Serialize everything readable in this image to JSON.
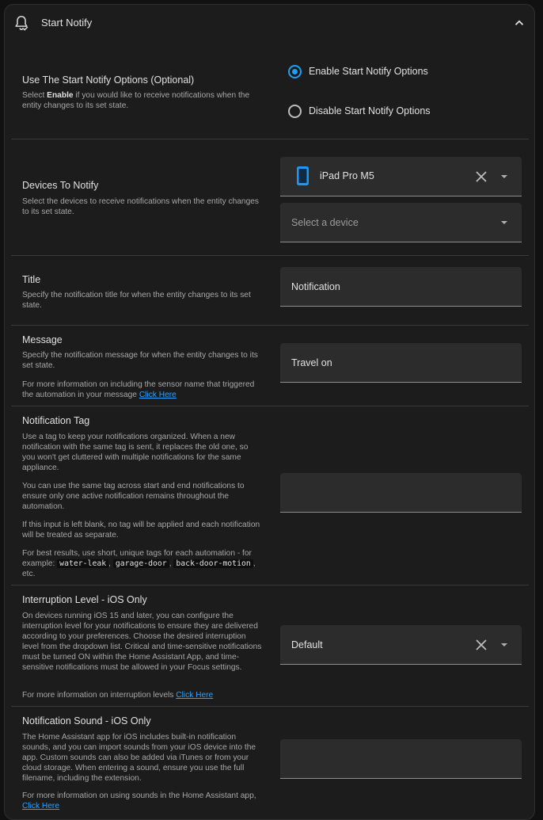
{
  "header": {
    "title": "Start Notify",
    "bell_icon": "bell-check-icon",
    "collapse_icon": "chevron-up-icon"
  },
  "start_options": {
    "title": "Use The Start Notify Options (Optional)",
    "desc_pre": "Select ",
    "desc_bold": "Enable",
    "desc_post": " if you would like to receive notifications when the entity changes to its set state.",
    "enable_label": "Enable Start Notify Options",
    "disable_label": "Disable Start Notify Options",
    "selected": "enable"
  },
  "devices": {
    "title": "Devices To Notify",
    "desc": "Select the devices to receive notifications when the entity changes to its set state.",
    "selected_device": "iPad Pro M5",
    "device_icon": "tablet-icon",
    "placeholder": "Select a device"
  },
  "title_field": {
    "title": "Title",
    "desc": "Specify the notification title for when the entity changes to its set state.",
    "value": "Notification"
  },
  "message_field": {
    "title": "Message",
    "desc": "Specify the notification message for when the entity changes to its set state.",
    "info": "For more information on including the sensor name that triggered the automation in your message ",
    "link": "Click Here",
    "value": "Travel on"
  },
  "tag_field": {
    "title": "Notification Tag",
    "p1": "Use a tag to keep your notifications organized. When a new notification with the same tag is sent, it replaces the old one, so you won't get cluttered with multiple notifications for the same appliance.",
    "p2": "You can use the same tag across start and end notifications to ensure only one active notification remains throughout the automation.",
    "p3": "If this input is left blank, no tag will be applied and each notification will be treated as separate.",
    "p4_pre": "For best results, use short, unique tags for each automation - for example: ",
    "examples": [
      "water-leak",
      "garage-door",
      "back-door-motion"
    ],
    "sep": ", ",
    "p4_post": ", etc.",
    "value": ""
  },
  "interruption_field": {
    "title": "Interruption Level - iOS Only",
    "desc": "On devices running iOS 15 and later, you can configure the interruption level for your notifications to ensure they are delivered according to your preferences. Choose the desired interruption level from the dropdown list. Critical and time-sensitive notifications must be turned ON within the Home Assistant App, and time-sensitive notifications must be allowed in your Focus settings.",
    "info": "For more information on interruption levels ",
    "link": "Click Here",
    "value": "Default"
  },
  "sound_field": {
    "title": "Notification Sound - iOS Only",
    "desc": "The Home Assistant app for iOS includes built-in notification sounds, and you can import sounds from your iOS device into the app. Custom sounds can also be added via iTunes or from your cloud storage. When entering a sound, ensure you use the full filename, including the extension.",
    "info": "For more information on using sounds in the Home Assistant app, ",
    "link": "Click Here",
    "value": ""
  },
  "colors": {
    "accent": "#1e9ff2",
    "link": "#2aa2ff",
    "surface": "#1c1c1c",
    "input_bg": "#2c2c2c"
  }
}
